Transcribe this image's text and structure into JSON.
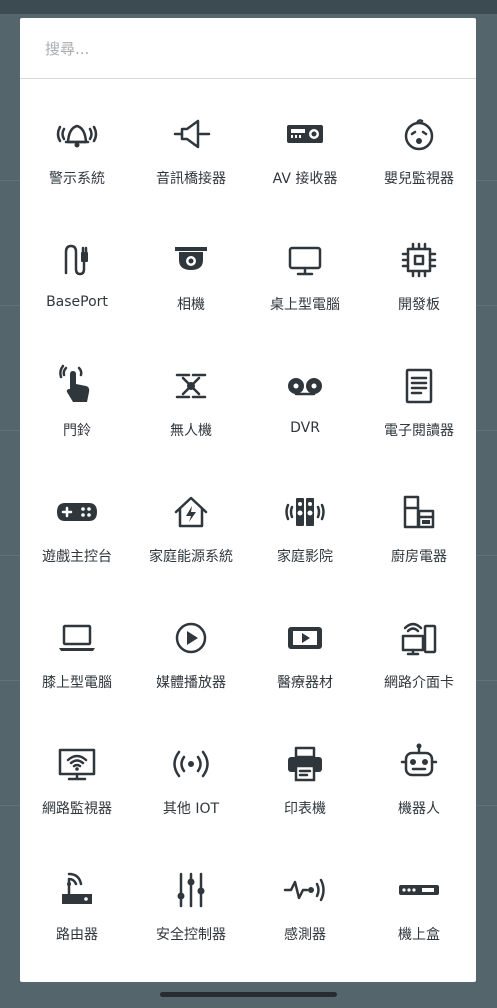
{
  "search": {
    "placeholder": "搜尋..."
  },
  "colors": {
    "icon": "#30373c",
    "backdrop": "#55656c",
    "dialog": "#ffffff"
  },
  "devices": [
    {
      "label": "警示系統",
      "icon": "bell-alarm-icon"
    },
    {
      "label": "音訊橋接器",
      "icon": "speaker-bridge-icon"
    },
    {
      "label": "AV 接收器",
      "icon": "av-receiver-icon"
    },
    {
      "label": "嬰兒監視器",
      "icon": "baby-face-icon"
    },
    {
      "label": "BasePort",
      "icon": "cable-plug-icon"
    },
    {
      "label": "相機",
      "icon": "camera-icon"
    },
    {
      "label": "桌上型電腦",
      "icon": "desktop-monitor-icon"
    },
    {
      "label": "開發板",
      "icon": "chip-icon"
    },
    {
      "label": "門鈴",
      "icon": "hand-press-icon"
    },
    {
      "label": "無人機",
      "icon": "drone-icon"
    },
    {
      "label": "DVR",
      "icon": "tape-reel-icon"
    },
    {
      "label": "電子閱讀器",
      "icon": "ereader-icon"
    },
    {
      "label": "遊戲主控台",
      "icon": "gamepad-icon"
    },
    {
      "label": "家庭能源系統",
      "icon": "house-bolt-icon"
    },
    {
      "label": "家庭影院",
      "icon": "tower-speakers-icon"
    },
    {
      "label": "廚房電器",
      "icon": "kitchen-appliance-icon"
    },
    {
      "label": "膝上型電腦",
      "icon": "laptop-icon"
    },
    {
      "label": "媒體播放器",
      "icon": "play-circle-icon"
    },
    {
      "label": "醫療器材",
      "icon": "media-screen-icon"
    },
    {
      "label": "網路介面卡",
      "icon": "network-devices-icon"
    },
    {
      "label": "網路監視器",
      "icon": "wifi-monitor-icon"
    },
    {
      "label": "其他 IOT",
      "icon": "signal-broadcast-icon"
    },
    {
      "label": "印表機",
      "icon": "printer-icon"
    },
    {
      "label": "機器人",
      "icon": "robot-icon"
    },
    {
      "label": "路由器",
      "icon": "router-icon"
    },
    {
      "label": "安全控制器",
      "icon": "sliders-icon"
    },
    {
      "label": "感測器",
      "icon": "sensor-wave-icon"
    },
    {
      "label": "機上盒",
      "icon": "set-top-box-icon"
    }
  ]
}
